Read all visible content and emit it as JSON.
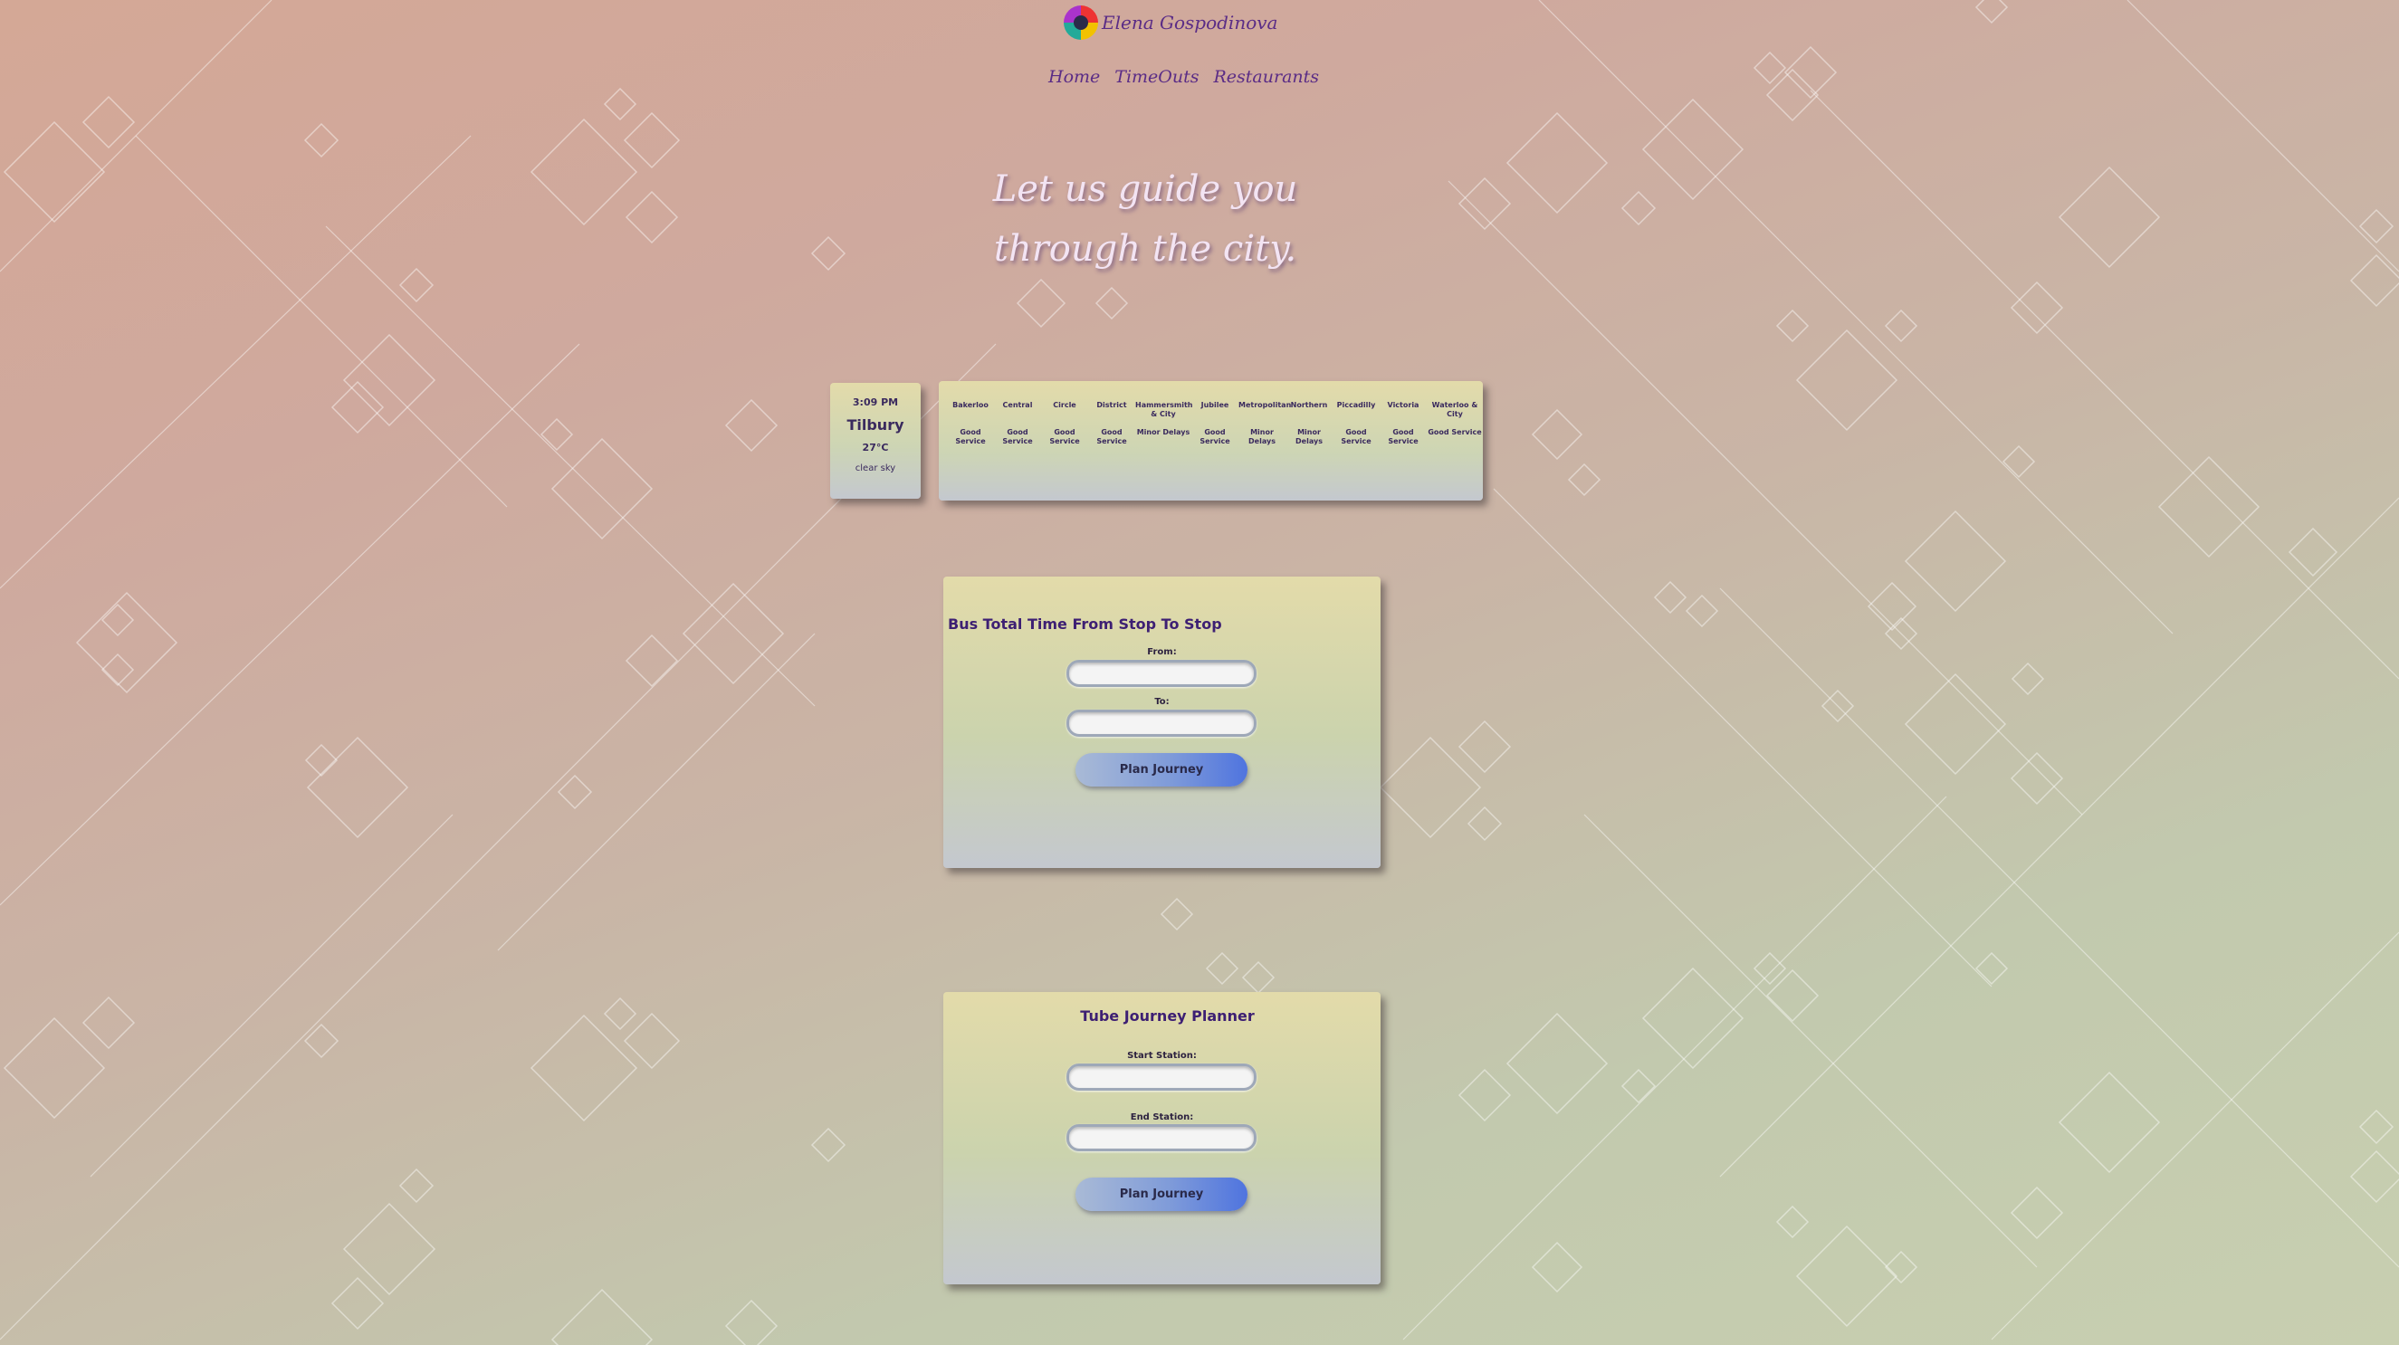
{
  "header": {
    "brand_name": "Elena Gospodinova",
    "logo_icon": "colorful-camera-logo",
    "nav": [
      "Home",
      "TimeOuts",
      "Restaurants"
    ]
  },
  "hero": {
    "line1": "Let us guide you",
    "line2": "through the city."
  },
  "weather": {
    "time": "3:09 PM",
    "city": "Tilbury",
    "temp": "27°C",
    "description": "clear sky"
  },
  "tube_status": [
    {
      "line": "Bakerloo",
      "status": "Good Service"
    },
    {
      "line": "Central",
      "status": "Good Service"
    },
    {
      "line": "Circle",
      "status": "Good Service"
    },
    {
      "line": "District",
      "status": "Good Service"
    },
    {
      "line": "Hammersmith & City",
      "status": "Minor Delays"
    },
    {
      "line": "Jubilee",
      "status": "Good Service"
    },
    {
      "line": "Metropolitan",
      "status": "Minor Delays"
    },
    {
      "line": "Northern",
      "status": "Minor Delays"
    },
    {
      "line": "Piccadilly",
      "status": "Good Service"
    },
    {
      "line": "Victoria",
      "status": "Good Service"
    },
    {
      "line": "Waterloo & City",
      "status": "Good Service"
    }
  ],
  "bus": {
    "title": "Bus Total Time From Stop To Stop",
    "from_label": "From:",
    "from_value": "",
    "to_label": "To:",
    "to_value": "",
    "button": "Plan Journey"
  },
  "planner": {
    "title": "Tube Journey Planner",
    "start_label": "Start Station:",
    "start_value": "",
    "end_label": "End Station:",
    "end_value": "",
    "button": "Plan Journey"
  },
  "colors": {
    "accent": "#5a2c86",
    "title": "#3d1f73",
    "button_end": "#4f74df"
  }
}
